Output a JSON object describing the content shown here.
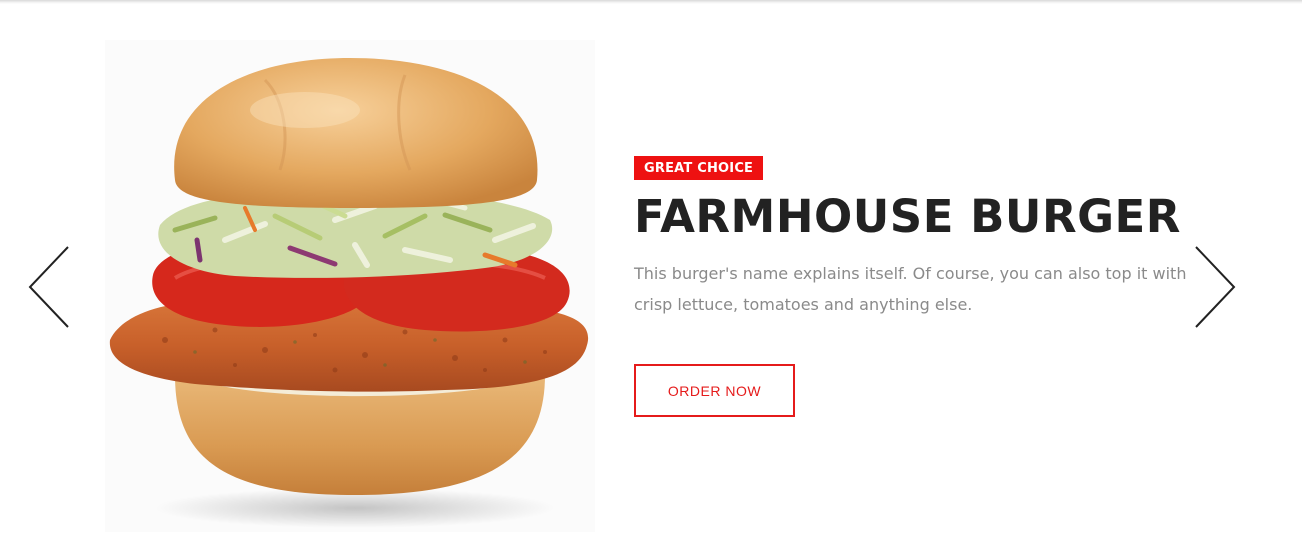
{
  "slide": {
    "badge": "GREAT CHOICE",
    "title": "FARMHOUSE BURGER",
    "description": "This burger's name explains itself. Of course, you can also top it with crisp lettuce, tomatoes and anything else.",
    "cta_label": "ORDER NOW",
    "image_subject": "chicken sandwich with coleslaw and tomato"
  },
  "controls": {
    "prev_icon": "chevron-left-icon",
    "next_icon": "chevron-right-icon"
  },
  "colors": {
    "accent": "#ee1111",
    "title": "#222222",
    "body_text": "#8a8a8a",
    "arrow": "#222222"
  }
}
